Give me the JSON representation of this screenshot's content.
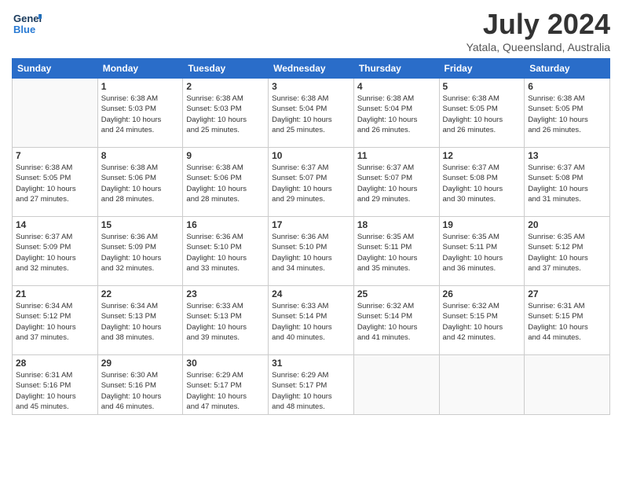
{
  "logo": {
    "line1": "General",
    "line2": "Blue"
  },
  "title": "July 2024",
  "location": "Yatala, Queensland, Australia",
  "weekdays": [
    "Sunday",
    "Monday",
    "Tuesday",
    "Wednesday",
    "Thursday",
    "Friday",
    "Saturday"
  ],
  "weeks": [
    [
      {
        "day": "",
        "info": ""
      },
      {
        "day": "1",
        "info": "Sunrise: 6:38 AM\nSunset: 5:03 PM\nDaylight: 10 hours\nand 24 minutes."
      },
      {
        "day": "2",
        "info": "Sunrise: 6:38 AM\nSunset: 5:03 PM\nDaylight: 10 hours\nand 25 minutes."
      },
      {
        "day": "3",
        "info": "Sunrise: 6:38 AM\nSunset: 5:04 PM\nDaylight: 10 hours\nand 25 minutes."
      },
      {
        "day": "4",
        "info": "Sunrise: 6:38 AM\nSunset: 5:04 PM\nDaylight: 10 hours\nand 26 minutes."
      },
      {
        "day": "5",
        "info": "Sunrise: 6:38 AM\nSunset: 5:05 PM\nDaylight: 10 hours\nand 26 minutes."
      },
      {
        "day": "6",
        "info": "Sunrise: 6:38 AM\nSunset: 5:05 PM\nDaylight: 10 hours\nand 26 minutes."
      }
    ],
    [
      {
        "day": "7",
        "info": "Sunrise: 6:38 AM\nSunset: 5:05 PM\nDaylight: 10 hours\nand 27 minutes."
      },
      {
        "day": "8",
        "info": "Sunrise: 6:38 AM\nSunset: 5:06 PM\nDaylight: 10 hours\nand 28 minutes."
      },
      {
        "day": "9",
        "info": "Sunrise: 6:38 AM\nSunset: 5:06 PM\nDaylight: 10 hours\nand 28 minutes."
      },
      {
        "day": "10",
        "info": "Sunrise: 6:37 AM\nSunset: 5:07 PM\nDaylight: 10 hours\nand 29 minutes."
      },
      {
        "day": "11",
        "info": "Sunrise: 6:37 AM\nSunset: 5:07 PM\nDaylight: 10 hours\nand 29 minutes."
      },
      {
        "day": "12",
        "info": "Sunrise: 6:37 AM\nSunset: 5:08 PM\nDaylight: 10 hours\nand 30 minutes."
      },
      {
        "day": "13",
        "info": "Sunrise: 6:37 AM\nSunset: 5:08 PM\nDaylight: 10 hours\nand 31 minutes."
      }
    ],
    [
      {
        "day": "14",
        "info": "Sunrise: 6:37 AM\nSunset: 5:09 PM\nDaylight: 10 hours\nand 32 minutes."
      },
      {
        "day": "15",
        "info": "Sunrise: 6:36 AM\nSunset: 5:09 PM\nDaylight: 10 hours\nand 32 minutes."
      },
      {
        "day": "16",
        "info": "Sunrise: 6:36 AM\nSunset: 5:10 PM\nDaylight: 10 hours\nand 33 minutes."
      },
      {
        "day": "17",
        "info": "Sunrise: 6:36 AM\nSunset: 5:10 PM\nDaylight: 10 hours\nand 34 minutes."
      },
      {
        "day": "18",
        "info": "Sunrise: 6:35 AM\nSunset: 5:11 PM\nDaylight: 10 hours\nand 35 minutes."
      },
      {
        "day": "19",
        "info": "Sunrise: 6:35 AM\nSunset: 5:11 PM\nDaylight: 10 hours\nand 36 minutes."
      },
      {
        "day": "20",
        "info": "Sunrise: 6:35 AM\nSunset: 5:12 PM\nDaylight: 10 hours\nand 37 minutes."
      }
    ],
    [
      {
        "day": "21",
        "info": "Sunrise: 6:34 AM\nSunset: 5:12 PM\nDaylight: 10 hours\nand 37 minutes."
      },
      {
        "day": "22",
        "info": "Sunrise: 6:34 AM\nSunset: 5:13 PM\nDaylight: 10 hours\nand 38 minutes."
      },
      {
        "day": "23",
        "info": "Sunrise: 6:33 AM\nSunset: 5:13 PM\nDaylight: 10 hours\nand 39 minutes."
      },
      {
        "day": "24",
        "info": "Sunrise: 6:33 AM\nSunset: 5:14 PM\nDaylight: 10 hours\nand 40 minutes."
      },
      {
        "day": "25",
        "info": "Sunrise: 6:32 AM\nSunset: 5:14 PM\nDaylight: 10 hours\nand 41 minutes."
      },
      {
        "day": "26",
        "info": "Sunrise: 6:32 AM\nSunset: 5:15 PM\nDaylight: 10 hours\nand 42 minutes."
      },
      {
        "day": "27",
        "info": "Sunrise: 6:31 AM\nSunset: 5:15 PM\nDaylight: 10 hours\nand 44 minutes."
      }
    ],
    [
      {
        "day": "28",
        "info": "Sunrise: 6:31 AM\nSunset: 5:16 PM\nDaylight: 10 hours\nand 45 minutes."
      },
      {
        "day": "29",
        "info": "Sunrise: 6:30 AM\nSunset: 5:16 PM\nDaylight: 10 hours\nand 46 minutes."
      },
      {
        "day": "30",
        "info": "Sunrise: 6:29 AM\nSunset: 5:17 PM\nDaylight: 10 hours\nand 47 minutes."
      },
      {
        "day": "31",
        "info": "Sunrise: 6:29 AM\nSunset: 5:17 PM\nDaylight: 10 hours\nand 48 minutes."
      },
      {
        "day": "",
        "info": ""
      },
      {
        "day": "",
        "info": ""
      },
      {
        "day": "",
        "info": ""
      }
    ]
  ]
}
